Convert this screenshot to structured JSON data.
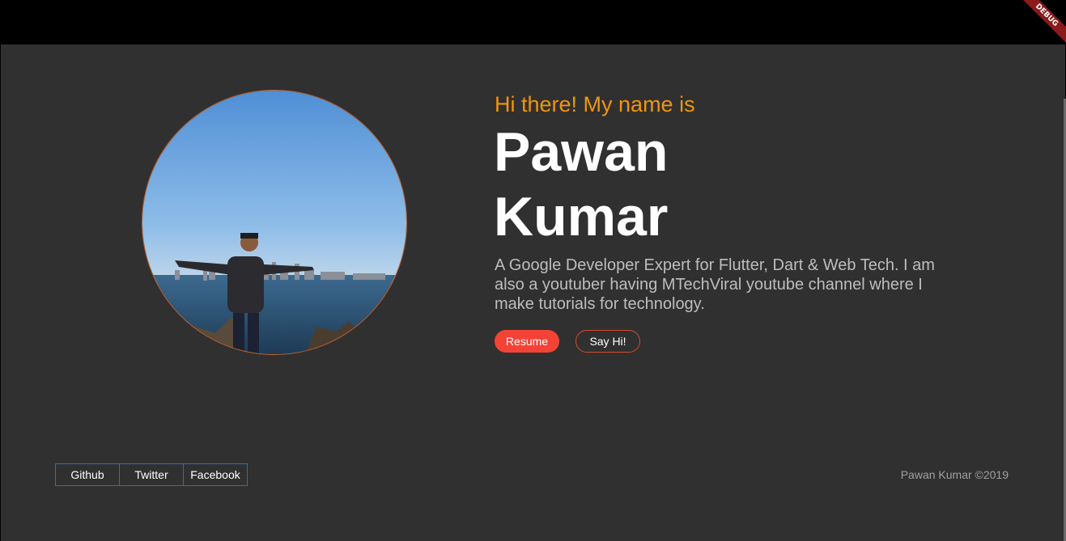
{
  "debug_banner": "DEBUG",
  "hero": {
    "greeting": "Hi there! My name is",
    "name_line1": "Pawan",
    "name_line2": "Kumar",
    "bio": "A Google Developer Expert for Flutter, Dart & Web Tech. I am also a youtuber having MTechViral youtube channel where I make tutorials for technology.",
    "resume_label": "Resume",
    "say_hi_label": "Say Hi!"
  },
  "socials": [
    "Github",
    "Twitter",
    "Facebook"
  ],
  "footer": "Pawan Kumar ©2019",
  "colors": {
    "accent_orange": "#f0950f",
    "resume_red": "#f44336",
    "link_border": "#2f6fb0",
    "background": "#303030"
  },
  "icons": {
    "avatar": "profile-photo"
  }
}
